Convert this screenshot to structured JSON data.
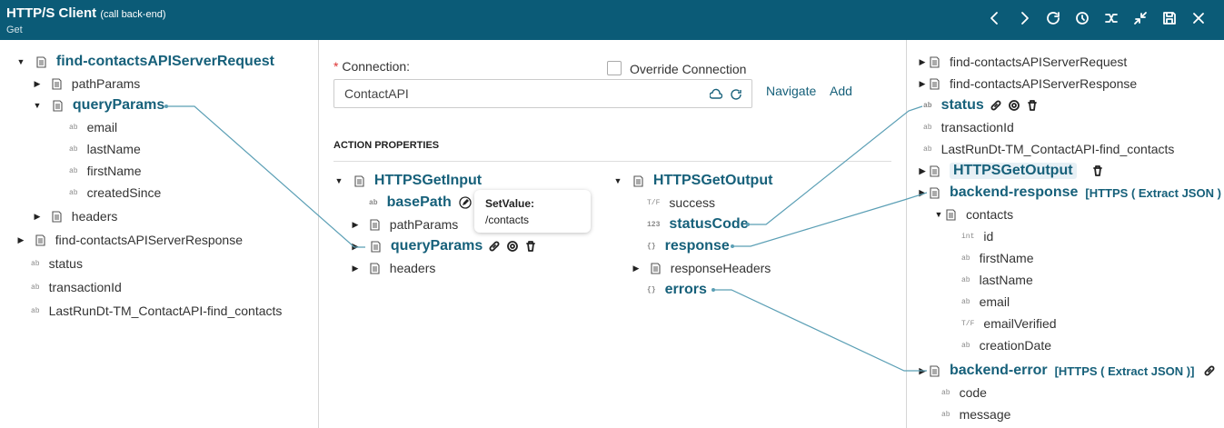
{
  "header": {
    "title": "HTTP/S Client",
    "subtitle": "(call back-end)",
    "mode": "Get",
    "icons": [
      "chevron-left-icon",
      "chevron-right-icon",
      "refresh-icon",
      "history-icon",
      "mapping-icon",
      "collapse-icon",
      "save-icon",
      "close-icon"
    ]
  },
  "left": {
    "root": "find-contactsAPIServerRequest",
    "pathParams": "pathParams",
    "queryParams": "queryParams",
    "q": [
      "email",
      "lastName",
      "firstName",
      "createdSince"
    ],
    "headers": "headers",
    "resp": "find-contactsAPIServerResponse",
    "status": "status",
    "txn": "transactionId",
    "last": "LastRunDt-TM_ContactAPI-find_contacts"
  },
  "middle": {
    "conn_label": "Connection",
    "conn_value": "ContactAPI",
    "override": "Override Connection",
    "navigate": "Navigate",
    "add": "Add",
    "section": "ACTION PROPERTIES",
    "input": {
      "title": "HTTPSGetInput",
      "basePath": "basePath",
      "pathParams": "pathParams",
      "queryParams": "queryParams",
      "headers": "headers"
    },
    "tooltip": {
      "title": "SetValue:",
      "value": "/contacts"
    },
    "output": {
      "title": "HTTPSGetOutput",
      "success": "success",
      "statusCode": "statusCode",
      "response": "response",
      "responseHeaders": "responseHeaders",
      "errors": "errors"
    }
  },
  "right": {
    "req": "find-contactsAPIServerRequest",
    "resp": "find-contactsAPIServerResponse",
    "status": "status",
    "txn": "transactionId",
    "last": "LastRunDt-TM_ContactAPI-find_contacts",
    "out": "HTTPSGetOutput",
    "br": "backend-response",
    "br_badge": "[HTTPS ( Extract JSON )",
    "contacts": "contacts",
    "fields": [
      "id",
      "firstName",
      "lastName",
      "email",
      "emailVerified",
      "creationDate"
    ],
    "be": "backend-error",
    "be_badge": "[HTTPS ( Extract JSON )]",
    "code": "code",
    "message": "message"
  },
  "type_labels": {
    "string": "ab",
    "int": "int",
    "bool": "T/F",
    "num": "123",
    "obj": "{}"
  }
}
